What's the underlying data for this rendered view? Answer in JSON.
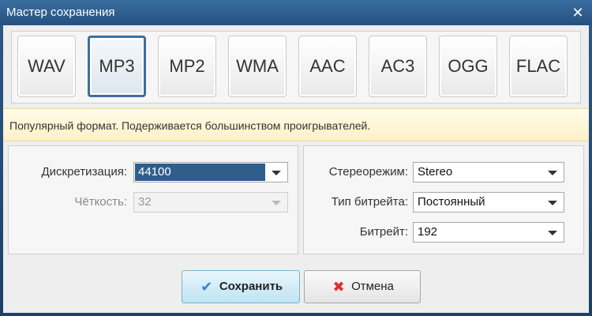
{
  "window": {
    "title": "Мастер сохранения",
    "close_glyph": "✕"
  },
  "formats": [
    {
      "label": "WAV",
      "active": false
    },
    {
      "label": "MP3",
      "active": true
    },
    {
      "label": "MP2",
      "active": false
    },
    {
      "label": "WMA",
      "active": false
    },
    {
      "label": "AAC",
      "active": false
    },
    {
      "label": "AC3",
      "active": false
    },
    {
      "label": "OGG",
      "active": false
    },
    {
      "label": "FLAC",
      "active": false
    }
  ],
  "info": "Популярный формат. Подерживается большинством проигрывателей.",
  "left_panel": {
    "sampling_label": "Дискретизация:",
    "sampling_value": "44100",
    "clarity_label": "Чёткость:",
    "clarity_value": "32"
  },
  "right_panel": {
    "stereo_label": "Стереорежим:",
    "stereo_value": "Stereo",
    "bitrate_type_label": "Тип битрейта:",
    "bitrate_type_value": "Постоянный",
    "bitrate_label": "Битрейт:",
    "bitrate_value": "192"
  },
  "buttons": {
    "save_label": "Сохранить",
    "cancel_label": "Отмена",
    "save_icon": "✔",
    "cancel_icon": "✖"
  },
  "colors": {
    "title_bar": "#2d5a88",
    "selection": "#2f5d8c",
    "info_bg": "#fdf1c6",
    "save_bg": "#bfe3f3",
    "cancel_icon": "#d9302b"
  }
}
